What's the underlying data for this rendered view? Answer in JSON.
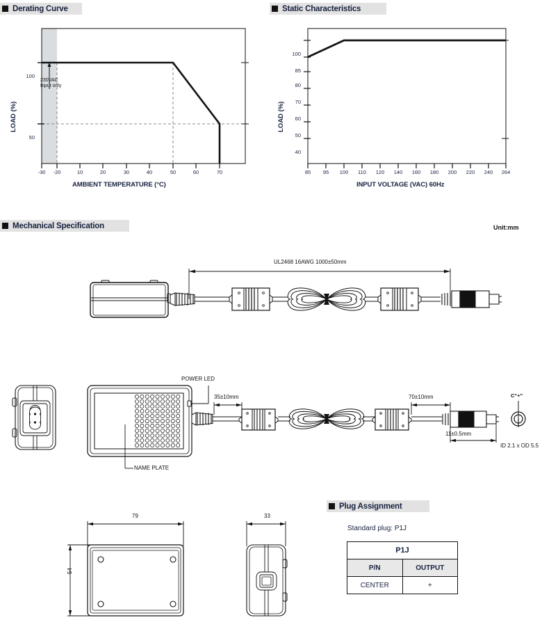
{
  "page": {
    "unit_note": "Unit:mm"
  },
  "sections": {
    "derating": {
      "title": "Derating Curve"
    },
    "static": {
      "title": "Static Characteristics"
    },
    "mechanical": {
      "title": "Mechanical Specification"
    },
    "plug": {
      "title": "Plug Assignment"
    }
  },
  "chart_data": [
    {
      "type": "line",
      "id": "derating-curve",
      "title": "Derating Curve",
      "xlabel": "AMBIENT TEMPERATURE (°C)",
      "ylabel": "LOAD (%)",
      "xticks": [
        -30,
        -20,
        10,
        20,
        30,
        40,
        50,
        60,
        70
      ],
      "xtick_labels": [
        "-30",
        "-20",
        "10",
        "20",
        "30",
        "40",
        "50",
        "60",
        "70"
      ],
      "yticks": [
        100,
        50
      ],
      "ytick_labels": [
        "100",
        "50"
      ],
      "xlim": [
        -30,
        78
      ],
      "ylim": [
        0,
        112
      ],
      "grid": false,
      "annotations": [
        {
          "text_line1": "230VAC",
          "text_line2": "Input only",
          "at_x": -20,
          "at_y": 100
        }
      ],
      "shaded_region": {
        "from_x": -30,
        "to_x": -20,
        "color": "#d9dde0"
      },
      "dashed_guides": [
        {
          "type": "vertical",
          "x": -20
        },
        {
          "type": "vertical",
          "x": 50
        },
        {
          "type": "horizontal",
          "y": 50
        }
      ],
      "x": [
        -30,
        -20,
        50,
        70,
        70
      ],
      "y": [
        100,
        100,
        100,
        50,
        0
      ],
      "series": [
        {
          "name": "Load derating",
          "x": [
            -30,
            -20,
            50,
            70,
            70
          ],
          "values": [
            100,
            100,
            100,
            50,
            0
          ]
        }
      ]
    },
    {
      "type": "line",
      "id": "static-characteristics",
      "title": "Static Characteristics",
      "xlabel": "INPUT VOLTAGE (VAC) 60Hz",
      "ylabel": "LOAD (%)",
      "xticks": [
        85,
        95,
        100,
        110,
        120,
        140,
        160,
        180,
        200,
        220,
        240,
        264
      ],
      "xtick_labels": [
        "85",
        "95",
        "100",
        "110",
        "120",
        "140",
        "160",
        "180",
        "200",
        "220",
        "240",
        "264"
      ],
      "yticks": [
        100,
        85,
        80,
        70,
        60,
        50,
        40
      ],
      "ytick_labels": [
        "100",
        "85",
        "80",
        "70",
        "60",
        "50",
        "40"
      ],
      "xlim": [
        85,
        264
      ],
      "ylim": [
        30,
        108
      ],
      "grid": false,
      "x": [
        85,
        100,
        264
      ],
      "y": [
        85,
        100,
        100
      ],
      "series": [
        {
          "name": "Load vs input voltage",
          "x": [
            85,
            100,
            264
          ],
          "values": [
            85,
            100,
            100
          ]
        }
      ]
    }
  ],
  "mechanical": {
    "cable_spec": "UL2468 16AWG 1000±50mm",
    "power_led_label": "POWER LED",
    "name_plate_label": "NAME PLATE",
    "dim_strain_relief": "35±10mm",
    "dim_output_cord": "70±10mm",
    "dim_plug_barrel": "11±0.5mm",
    "polarity_symbol": "C“+”",
    "barrel_spec": "ID 2.1 x OD 5.5",
    "dim_width": "79",
    "dim_height": "54",
    "dim_depth": "33"
  },
  "plug_assignment": {
    "standard_plug": "Standard plug: P1J",
    "table": {
      "title": "P1J",
      "headers": [
        "P/N",
        "OUTPUT"
      ],
      "rows": [
        [
          "CENTER",
          "+"
        ]
      ]
    }
  }
}
